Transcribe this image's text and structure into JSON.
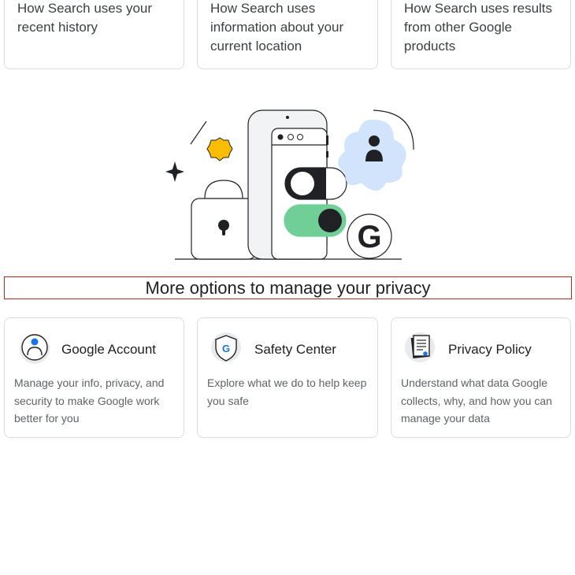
{
  "top_cards": [
    {
      "text": "How Search uses your recent history"
    },
    {
      "text": "How Search uses information about your current location"
    },
    {
      "text": "How Search uses results from other Google products"
    }
  ],
  "section": {
    "heading": "More options to manage your privacy"
  },
  "option_cards": [
    {
      "title": "Google Account",
      "description": "Manage your info, privacy, and security to make Google work better for you",
      "icon": "account-circle-icon"
    },
    {
      "title": "Safety Center",
      "description": "Explore what we do to help keep you safe",
      "icon": "shield-google-icon"
    },
    {
      "title": "Privacy Policy",
      "description": "Understand what data Google collects, why, and how you can manage your data",
      "icon": "policy-document-icon"
    }
  ],
  "illustration": {
    "google_logo_letter": "G"
  },
  "colors": {
    "accent_blue": "#1a73e8",
    "toggle_green": "#6fcf97",
    "badge_yellow": "#fbbc04",
    "avatar_bg": "#d2e3fc"
  }
}
